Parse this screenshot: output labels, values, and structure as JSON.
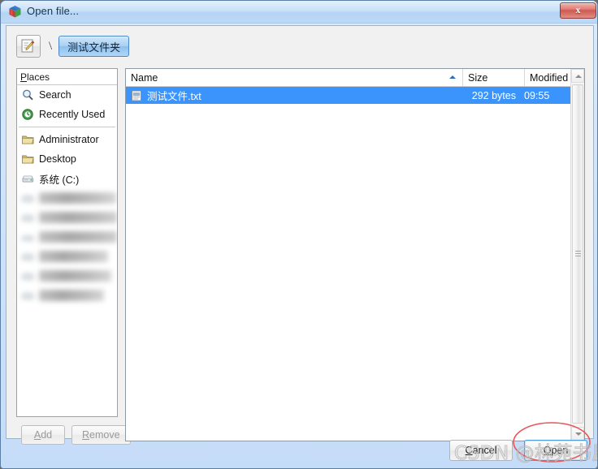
{
  "window": {
    "title": "Open file...",
    "title_icon": "cube-app-icon",
    "close_label": "x"
  },
  "pathbar": {
    "edit_icon": "pencil-edit-icon",
    "separator": "\\",
    "crumbs": [
      {
        "label": "测试文件夹",
        "active": true
      }
    ]
  },
  "places": {
    "header": {
      "prefix": "P",
      "rest": "laces"
    },
    "items": [
      {
        "label": "Search",
        "icon": "magnifier-icon",
        "blurred": false
      },
      {
        "label": "Recently Used",
        "icon": "clock-icon",
        "blurred": false
      },
      {
        "divider": true
      },
      {
        "label": "Administrator",
        "icon": "folder-icon",
        "blurred": false
      },
      {
        "label": "Desktop",
        "icon": "folder-icon",
        "blurred": false
      },
      {
        "label": "系统 (C:)",
        "icon": "drive-icon",
        "blurred": false
      },
      {
        "label": "████████ (D:)",
        "icon": "drive-icon",
        "blurred": true
      },
      {
        "label": "█████████ (E:)",
        "icon": "drive-icon",
        "blurred": true
      },
      {
        "label": "████████████",
        "icon": "drive-icon",
        "blurred": true
      },
      {
        "label": "███████ (F:)",
        "icon": "drive-icon",
        "blurred": true
      },
      {
        "label": "██████████",
        "icon": "drive-icon",
        "blurred": true
      },
      {
        "label": "█████████",
        "icon": "drive-icon",
        "blurred": true
      }
    ],
    "add_label": "Add",
    "add_mn": "A",
    "add_rest": "dd",
    "remove_mn": "R",
    "remove_rest": "emove"
  },
  "filelist": {
    "columns": [
      {
        "key": "name",
        "label": "Name",
        "sorted": "asc"
      },
      {
        "key": "size",
        "label": "Size"
      },
      {
        "key": "modified",
        "label": "Modified"
      }
    ],
    "rows": [
      {
        "icon": "text-file-icon",
        "name": "测试文件.txt",
        "size": "292 bytes",
        "modified": "09:55",
        "selected": true
      }
    ]
  },
  "footer": {
    "cancel_mn": "C",
    "cancel_rest": "ancel",
    "open_mn": "O",
    "open_rest": "pen"
  },
  "annotation": {
    "shape": "red-ellipse-highlight",
    "target": "open-button",
    "color": "#e8555a"
  },
  "watermark": {
    "text": "CSDN @林苑书屋",
    "color": "#bdbdbd"
  },
  "colors": {
    "selection_blue": "#3a94fb",
    "titlebar_blue": "#bcd9f6",
    "crumb_active": "#8dc0ee",
    "annotation_red": "#e8555a"
  }
}
